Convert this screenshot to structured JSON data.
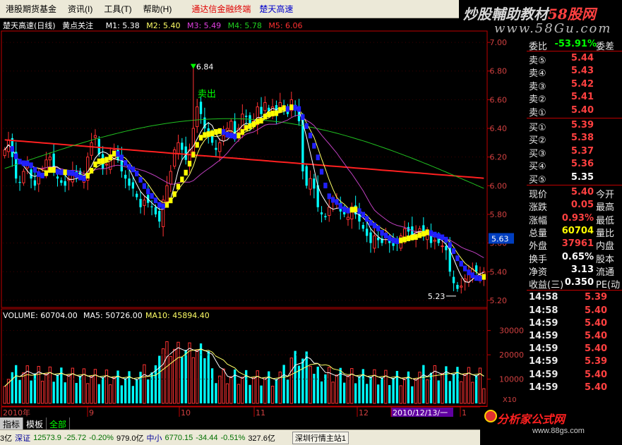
{
  "menubar": {
    "items": [
      "港股期货基金",
      "资讯(I)",
      "工具(T)",
      "帮助(H)"
    ],
    "highlight1": "通达信金融终端",
    "highlight2": "楚天高速"
  },
  "brand": {
    "line1_a": "炒股輔助教材",
    "line1_b": "58股网",
    "line2": "www.58Gu.com"
  },
  "chart_header": {
    "stock": "楚天高速(日线)",
    "indicator": "黄点关注",
    "m1": "M1: 5.38",
    "m2": "M2: 5.40",
    "m3": "M3: 5.49",
    "m4": "M4: 5.78",
    "m5": "M5: 6.06"
  },
  "colors": {
    "up": "#ff3232",
    "down": "#00ffff",
    "ma_red": "#ff2020",
    "ma_green": "#20c020",
    "ma_magenta": "#c040c0",
    "ma_yellow": "#ffff66",
    "ma_white": "#ffffff",
    "yellow_dots": "#ffff00",
    "blue_dots": "#2020ff",
    "axis": "#c00000"
  },
  "chart_data": {
    "type": "candlestick",
    "price_axis": {
      "ticks": [
        "7.00",
        "6.80",
        "6.60",
        "6.40",
        "6.20",
        "6.00",
        "5.80",
        "5.60",
        "5.40",
        "5.20"
      ],
      "range": [
        5.17,
        7.03
      ],
      "current_label": "5.63"
    },
    "annotations": {
      "high": "6.84",
      "low": "5.23",
      "signal": "卖出"
    },
    "time_labels": [
      "2010年",
      "9",
      "10",
      "11",
      "12",
      "2010/12/13/一",
      "1"
    ],
    "volume": {
      "header_label": "VOLUME: 60704.00",
      "ma5_label": "MA5: 50726.00",
      "ma10_label": "MA10: 45894.40",
      "ticks": [
        "30000",
        "20000",
        "10000"
      ],
      "unit": "X10",
      "range": [
        0,
        36000
      ]
    },
    "close": [
      6.25,
      6.32,
      6.2,
      6.05,
      6.02,
      6.1,
      6.15,
      6.05,
      6.0,
      6.08,
      6.12,
      6.18,
      6.2,
      6.1,
      6.05,
      6.02,
      6.0,
      6.05,
      6.1,
      6.08,
      6.06,
      6.05,
      6.2,
      6.3,
      6.35,
      6.22,
      6.12,
      6.15,
      6.2,
      6.25,
      6.18,
      6.1,
      6.05,
      6.0,
      5.98,
      5.92,
      5.85,
      5.9,
      5.88,
      5.85,
      5.8,
      5.75,
      5.9,
      6.0,
      6.1,
      6.25,
      6.3,
      6.25,
      6.18,
      6.25,
      6.4,
      6.55,
      6.5,
      6.4,
      6.35,
      6.3,
      6.25,
      6.3,
      6.35,
      6.4,
      6.45,
      6.35,
      6.4,
      6.5,
      6.48,
      6.4,
      6.45,
      6.55,
      6.5,
      6.58,
      6.52,
      6.55,
      6.5,
      6.58,
      6.55,
      6.5,
      6.6,
      6.55,
      6.45,
      6.1,
      6.0,
      6.05,
      5.98,
      5.85,
      5.8,
      5.78,
      5.85,
      5.9,
      5.88,
      5.82,
      5.8,
      5.78,
      5.85,
      5.8,
      5.75,
      5.7,
      5.65,
      5.6,
      5.65,
      5.62,
      5.6,
      5.65,
      5.6,
      5.58,
      5.6,
      5.65,
      5.7,
      5.68,
      5.65,
      5.68,
      5.7,
      5.66,
      5.68,
      5.6,
      5.62,
      5.6,
      5.58,
      5.55,
      5.4,
      5.32,
      5.28,
      5.3,
      5.35,
      5.38,
      5.42,
      5.4,
      5.38,
      5.4
    ]
  },
  "panel": {
    "weibi": {
      "label": "委比",
      "value": "-53.91%",
      "right": "委差"
    },
    "asks": [
      {
        "label": "卖⑤",
        "price": "5.44"
      },
      {
        "label": "卖④",
        "price": "5.43"
      },
      {
        "label": "卖③",
        "price": "5.42"
      },
      {
        "label": "卖②",
        "price": "5.41"
      },
      {
        "label": "卖①",
        "price": "5.40"
      }
    ],
    "bids": [
      {
        "label": "买①",
        "price": "5.39"
      },
      {
        "label": "买②",
        "price": "5.38"
      },
      {
        "label": "买③",
        "price": "5.37"
      },
      {
        "label": "买④",
        "price": "5.36"
      },
      {
        "label": "买⑤",
        "price": "5.35"
      }
    ],
    "stats": [
      {
        "label": "现价",
        "value": "5.40",
        "right": "今开",
        "color": "#ff4040"
      },
      {
        "label": "涨跌",
        "value": "0.05",
        "right": "最高",
        "color": "#ff4040"
      },
      {
        "label": "涨幅",
        "value": "0.93%",
        "right": "最低",
        "color": "#ff4040"
      },
      {
        "label": "总量",
        "value": "60704",
        "right": "量比",
        "color": "#ffff00"
      },
      {
        "label": "外盘",
        "value": "37961",
        "right": "内盘",
        "color": "#ff4040"
      },
      {
        "label": "换手",
        "value": "0.65%",
        "right": "股本",
        "color": "#ffffff"
      },
      {
        "label": "净资",
        "value": "3.13",
        "right": "流通",
        "color": "#ffffff"
      },
      {
        "label": "收益(三)",
        "value": "0.350",
        "right": "PE(动",
        "color": "#ffffff"
      }
    ],
    "ticks": [
      {
        "time": "14:58",
        "price": "5.39"
      },
      {
        "time": "14:58",
        "price": "5.40"
      },
      {
        "time": "14:59",
        "price": "5.40"
      },
      {
        "time": "14:59",
        "price": "5.40"
      },
      {
        "time": "14:59",
        "price": "5.40"
      },
      {
        "time": "14:59",
        "price": "5.39"
      },
      {
        "time": "14:59",
        "price": "5.40"
      },
      {
        "time": "14:59",
        "price": "5.40"
      }
    ]
  },
  "tabs": [
    "指标",
    "模板",
    "全部"
  ],
  "status": {
    "sh_label": "3亿",
    "sh_name": "深证",
    "sh_value": "12573.9",
    "sh_change": "-25.72",
    "sh_pct": "-0.20%",
    "sh_amount": "979.0亿",
    "zx_name": "中小",
    "zx_value": "6770.15",
    "zx_change": "-34.44",
    "zx_pct": "-0.51%",
    "zx_amount": "327.6亿",
    "conn": "深圳行情主站1"
  },
  "footer_brand": {
    "text": "分析家公式网",
    "url": "www.88gs.com"
  }
}
